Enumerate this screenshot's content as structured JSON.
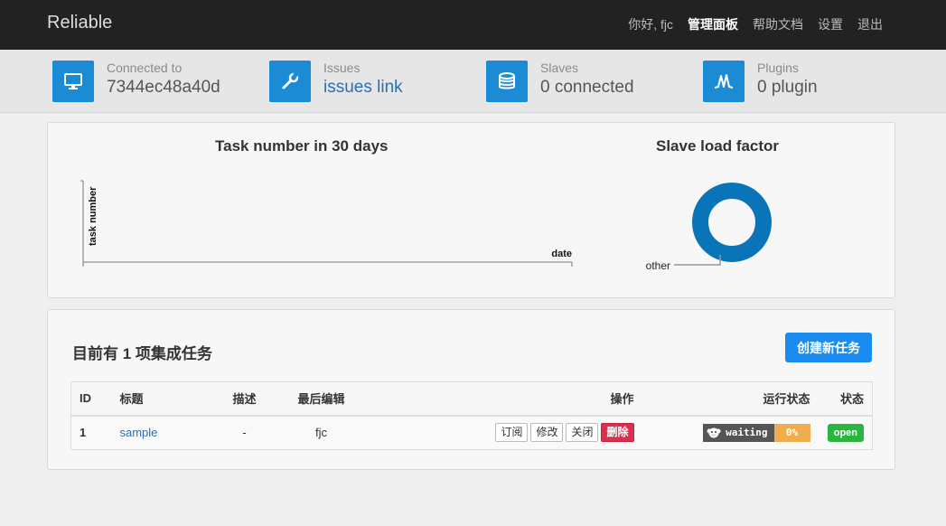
{
  "navbar": {
    "brand": "Reliable",
    "greeting": "你好,",
    "user": "fjc",
    "admin": "管理面板",
    "help": "帮助文档",
    "settings": "设置",
    "logout": "退出"
  },
  "stats": [
    {
      "label": "Connected to",
      "value": "7344ec48a40d",
      "icon": "monitor-icon"
    },
    {
      "label": "Issues",
      "value": "issues link",
      "icon": "wrench-icon"
    },
    {
      "label": "Slaves",
      "value": "0 connected",
      "icon": "database-icon"
    },
    {
      "label": "Plugins",
      "value": "0 plugin",
      "icon": "plugin-icon"
    }
  ],
  "colors": {
    "accent": "#1c8bd6",
    "donut": "#0a74b8",
    "create": "#1a8cf0",
    "danger": "#d9304f",
    "success": "#2ab540",
    "progress": "#f0ad4e"
  },
  "chart_data": [
    {
      "type": "line",
      "title": "Task number in 30 days",
      "xlabel": "date",
      "ylabel": "task number",
      "x": [],
      "series": []
    },
    {
      "type": "pie",
      "title": "Slave load factor",
      "labels": [
        "other"
      ],
      "values": [
        100
      ],
      "donut": true
    }
  ],
  "tasks": {
    "heading": "目前有 1 项集成任务",
    "create_label": "创建新任务",
    "columns": {
      "id": "ID",
      "title": "标题",
      "desc": "描述",
      "last_edit": "最后编辑",
      "ops": "操作",
      "run_status": "运行状态",
      "status": "状态"
    },
    "rows": [
      {
        "id": "1",
        "title": "sample",
        "desc": "-",
        "last_edit": "fjc",
        "ops": {
          "subscribe": "订阅",
          "edit": "修改",
          "close": "关闭",
          "delete": "删除"
        },
        "run_state": "waiting",
        "progress_label": "0%",
        "progress": 0,
        "status": "open"
      }
    ]
  }
}
